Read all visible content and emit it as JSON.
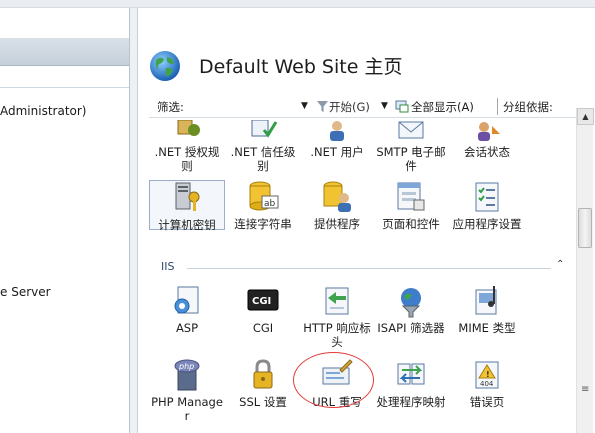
{
  "left_panel": {
    "items": [
      {
        "text": "Administrator)"
      },
      {
        "text": "e Server"
      }
    ]
  },
  "main": {
    "title": "Default Web Site 主页",
    "filter": {
      "label": "筛选:",
      "start": "开始(G)",
      "show_all": "全部显示(A)",
      "group_by": "分组依据:"
    },
    "rows": [
      {
        "items": [
          {
            "label": ".NET 授权规则",
            "icon": "net-auth-icon"
          },
          {
            "label": ".NET 信任级别",
            "icon": "net-trust-icon"
          },
          {
            "label": ".NET 用户",
            "icon": "net-users-icon"
          },
          {
            "label": "SMTP 电子邮件",
            "icon": "smtp-email-icon"
          },
          {
            "label": "会话状态",
            "icon": "session-state-icon"
          }
        ]
      },
      {
        "items": [
          {
            "label": "计算机密钥",
            "icon": "machine-key-icon"
          },
          {
            "label": "连接字符串",
            "icon": "connection-string-icon"
          },
          {
            "label": "提供程序",
            "icon": "providers-icon"
          },
          {
            "label": "页面和控件",
            "icon": "pages-controls-icon"
          },
          {
            "label": "应用程序设置",
            "icon": "app-settings-icon"
          }
        ]
      }
    ],
    "section": {
      "name": "IIS"
    },
    "iis_rows": [
      {
        "items": [
          {
            "label": "ASP",
            "icon": "asp-icon"
          },
          {
            "label": "CGI",
            "icon": "cgi-icon"
          },
          {
            "label": "HTTP 响应标头",
            "icon": "http-headers-icon"
          },
          {
            "label": "ISAPI 筛选器",
            "icon": "isapi-filters-icon"
          },
          {
            "label": "MIME 类型",
            "icon": "mime-types-icon"
          }
        ]
      },
      {
        "items": [
          {
            "label": "PHP Manager",
            "icon": "php-manager-icon"
          },
          {
            "label": "SSL 设置",
            "icon": "ssl-lock-icon"
          },
          {
            "label": "URL 重写",
            "icon": "url-rewrite-icon"
          },
          {
            "label": "处理程序映射",
            "icon": "handler-mappings-icon"
          },
          {
            "label": "错误页",
            "icon": "error-pages-icon"
          }
        ]
      }
    ]
  },
  "colors": {
    "accent_border": "#9aaec9",
    "annotation_circle": "#e23a3a",
    "section_text": "#2d4a6e"
  }
}
